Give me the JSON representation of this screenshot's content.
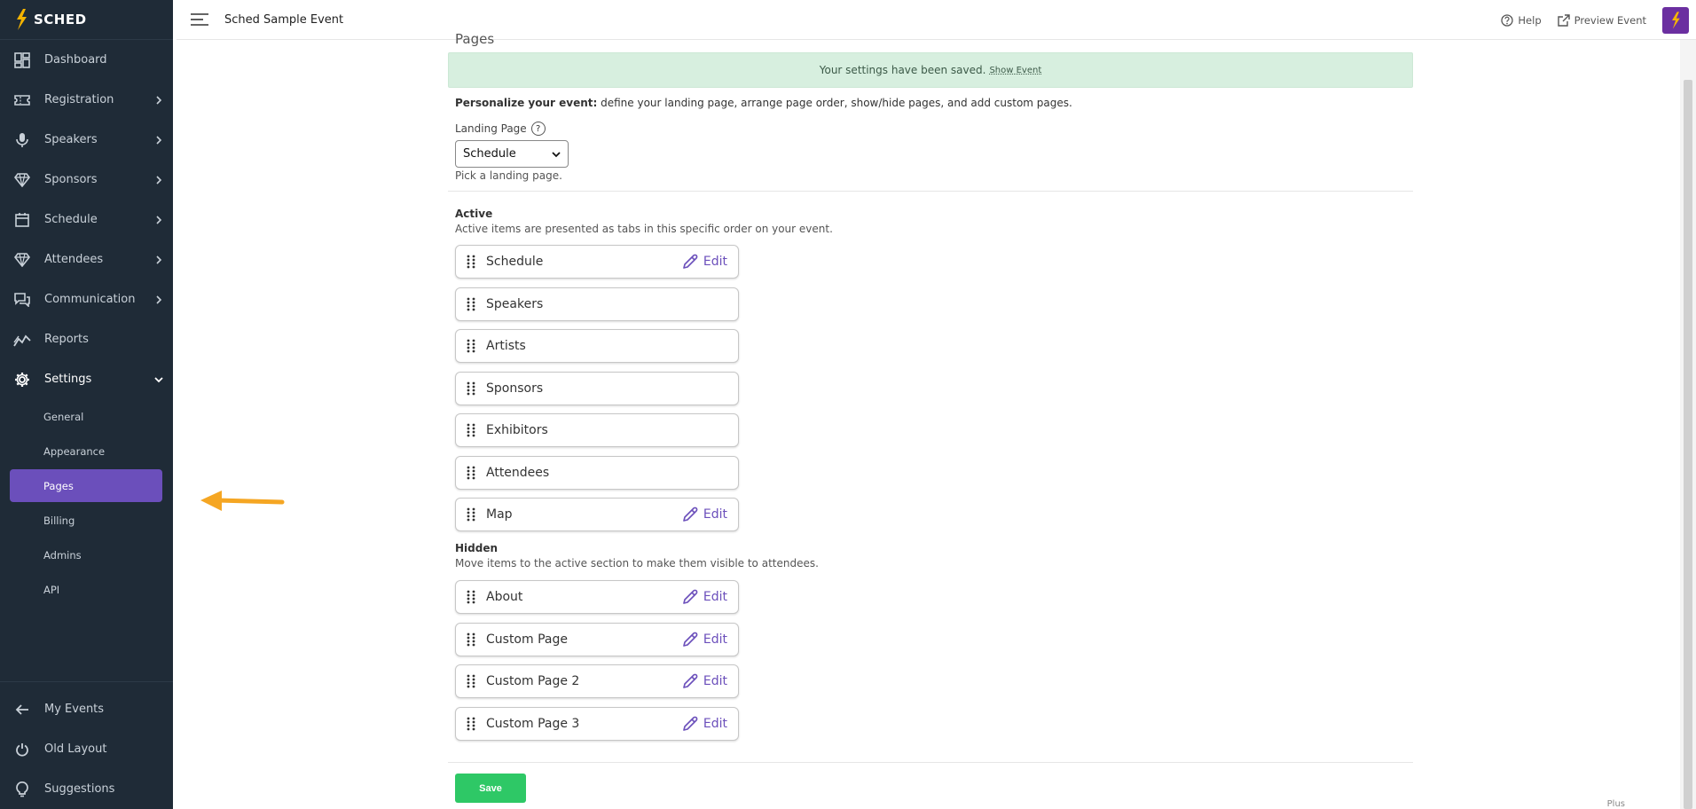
{
  "app": {
    "logo_text": "SCHED",
    "event_title": "Sched Sample Event"
  },
  "topbar": {
    "help_label": "Help",
    "preview_label": "Preview Event"
  },
  "sidebar": {
    "items": [
      {
        "label": "Dashboard",
        "icon": "dashboard-icon",
        "chevron": false
      },
      {
        "label": "Registration",
        "icon": "ticket-icon",
        "chevron": true
      },
      {
        "label": "Speakers",
        "icon": "microphone-icon",
        "chevron": true
      },
      {
        "label": "Sponsors",
        "icon": "diamond-icon",
        "chevron": true
      },
      {
        "label": "Schedule",
        "icon": "calendar-icon",
        "chevron": true
      },
      {
        "label": "Attendees",
        "icon": "diamond-icon",
        "chevron": true
      },
      {
        "label": "Communication",
        "icon": "chat-icon",
        "chevron": true
      },
      {
        "label": "Reports",
        "icon": "chart-icon",
        "chevron": false
      },
      {
        "label": "Settings",
        "icon": "gear-icon",
        "chevron": true
      }
    ],
    "settings_sub": [
      "General",
      "Appearance",
      "Pages",
      "Billing",
      "Admins",
      "API"
    ],
    "bottom": [
      {
        "label": "My Events",
        "icon": "arrow-left-icon"
      },
      {
        "label": "Old Layout",
        "icon": "power-icon"
      },
      {
        "label": "Suggestions",
        "icon": "lightbulb-icon"
      }
    ]
  },
  "main": {
    "heading": "Pages",
    "alert_text": "Your settings have been saved.",
    "alert_link": "Show Event",
    "intro_bold": "Personalize your event:",
    "intro_text": " define your landing page, arrange page order, show/hide pages, and add custom pages.",
    "landing_label": "Landing Page",
    "landing_help": "?",
    "landing_value": "Schedule",
    "landing_hint": "Pick a landing page.",
    "active_title": "Active",
    "active_desc": "Active items are presented as tabs in this specific order on your event.",
    "active_items": [
      {
        "name": "Schedule",
        "edit": true
      },
      {
        "name": "Speakers",
        "edit": false
      },
      {
        "name": "Artists",
        "edit": false
      },
      {
        "name": "Sponsors",
        "edit": false
      },
      {
        "name": "Exhibitors",
        "edit": false
      },
      {
        "name": "Attendees",
        "edit": false
      },
      {
        "name": "Map",
        "edit": true
      }
    ],
    "hidden_title": "Hidden",
    "hidden_desc": "Move items to the active section to make them visible to attendees.",
    "hidden_items": [
      {
        "name": "About",
        "edit": true
      },
      {
        "name": "Custom Page",
        "edit": true
      },
      {
        "name": "Custom Page 2",
        "edit": true
      },
      {
        "name": "Custom Page 3",
        "edit": true
      }
    ],
    "edit_label": "Edit",
    "save_label": "Save",
    "plan_label": "Plus"
  },
  "colors": {
    "sidebar_bg": "#1f2b37",
    "accent": "#6b4fbb",
    "alert_bg": "#d7efdf",
    "save_green": "#2ec866",
    "arrow_orange": "#f5a623"
  }
}
